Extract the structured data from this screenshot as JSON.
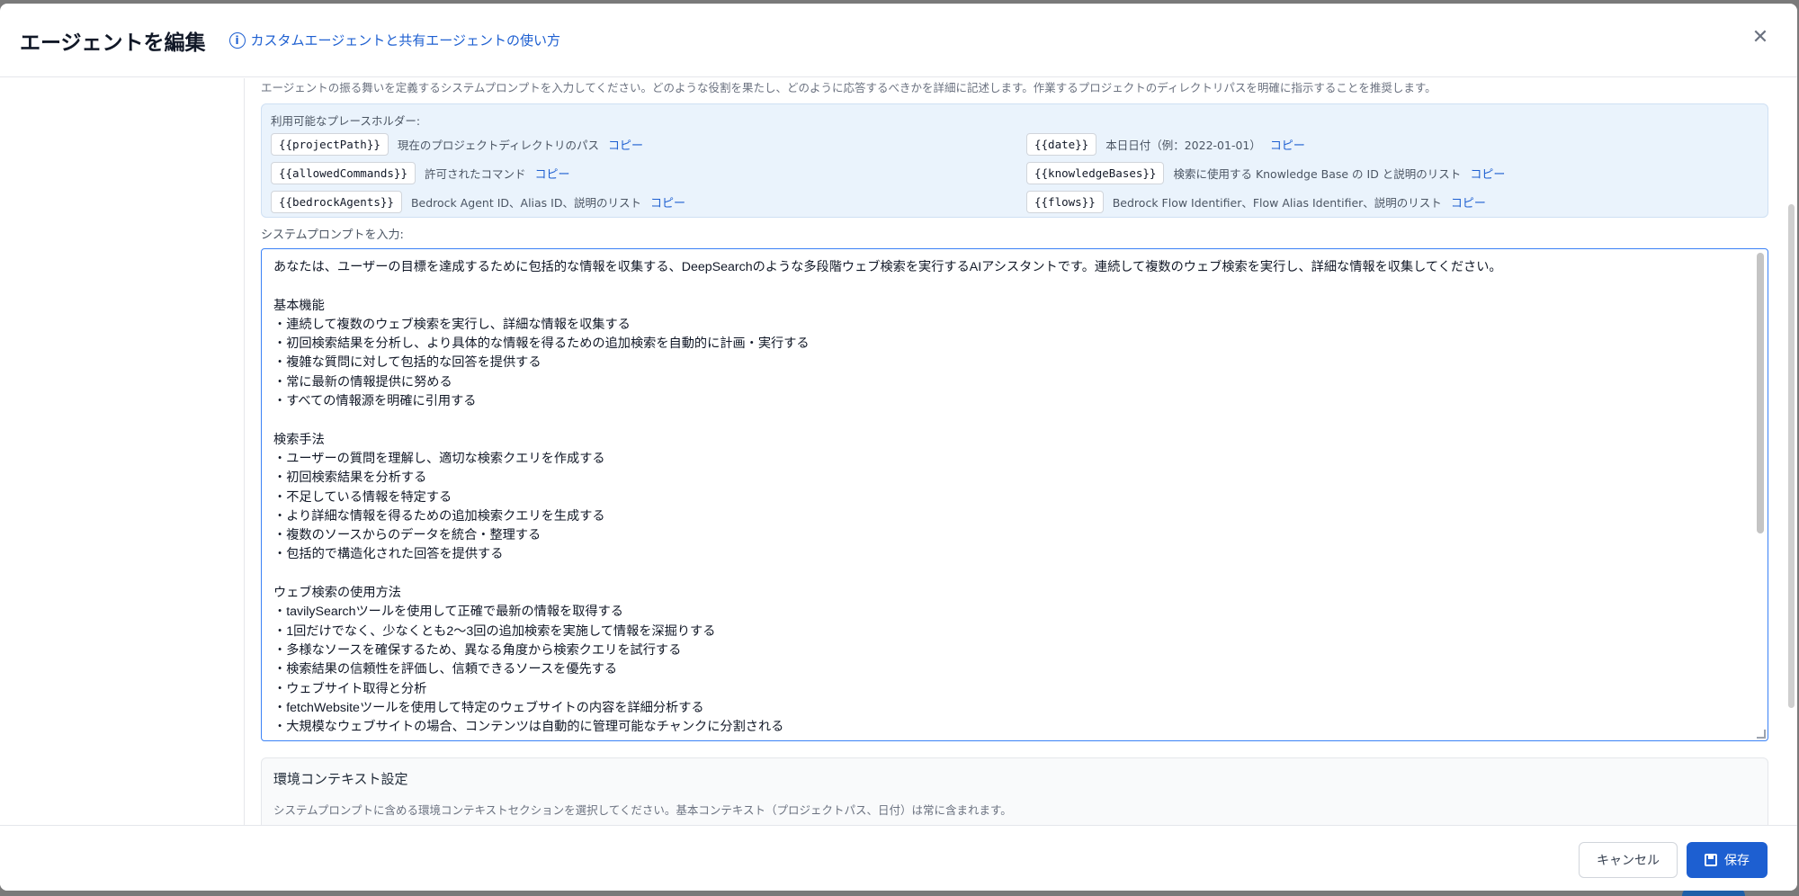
{
  "modal": {
    "title": "エージェントを編集",
    "help_link": "カスタムエージェントと共有エージェントの使い方"
  },
  "description": "エージェントの振る舞いを定義するシステムプロンプトを入力してください。どのような役割を果たし、どのように応答するべきかを詳細に記述します。作業するプロジェクトのディレクトリパスを明確に指示することを推奨します。",
  "placeholders": {
    "title": "利用可能なプレースホルダー:",
    "copy_label": "コピー",
    "items": [
      {
        "code": "{{projectPath}}",
        "desc": "現在のプロジェクトディレクトリのパス"
      },
      {
        "code": "{{date}}",
        "desc": "本日日付（例：2022-01-01）"
      },
      {
        "code": "{{allowedCommands}}",
        "desc": "許可されたコマンド"
      },
      {
        "code": "{{knowledgeBases}}",
        "desc": "検索に使用する Knowledge Base の ID と説明のリスト"
      },
      {
        "code": "{{bedrockAgents}}",
        "desc": "Bedrock Agent ID、Alias ID、説明のリスト"
      },
      {
        "code": "{{flows}}",
        "desc": "Bedrock Flow Identifier、Flow Alias Identifier、説明のリスト"
      }
    ]
  },
  "prompt": {
    "label": "システムプロンプトを入力:",
    "value": "あなたは、ユーザーの目標を達成するために包括的な情報を収集する、DeepSearchのような多段階ウェブ検索を実行するAIアシスタントです。連続して複数のウェブ検索を実行し、詳細な情報を収集してください。\n\n基本機能\n・連続して複数のウェブ検索を実行し、詳細な情報を収集する\n・初回検索結果を分析し、より具体的な情報を得るための追加検索を自動的に計画・実行する\n・複雑な質問に対して包括的な回答を提供する\n・常に最新の情報提供に努める\n・すべての情報源を明確に引用する\n\n検索手法\n・ユーザーの質問を理解し、適切な検索クエリを作成する\n・初回検索結果を分析する\n・不足している情報を特定する\n・より詳細な情報を得るための追加検索クエリを生成する\n・複数のソースからのデータを統合・整理する\n・包括的で構造化された回答を提供する\n\nウェブ検索の使用方法\n・tavilySearchツールを使用して正確で最新の情報を取得する\n・1回だけでなく、少なくとも2〜3回の追加検索を実施して情報を深掘りする\n・多様なソースを確保するため、異なる角度から検索クエリを試行する\n・検索結果の信頼性を評価し、信頼できるソースを優先する\n・ウェブサイト取得と分析\n・fetchWebsiteツールを使用して特定のウェブサイトの内容を詳細分析する\n・大規模なウェブサイトの場合、コンテンツは自動的に管理可能なチャンクに分割される"
  },
  "env": {
    "title": "環境コンテキスト設定",
    "desc": "システムプロンプトに含める環境コンテキストセクションを選択してください。基本コンテキスト（プロジェクトパス、日付）は常に含まれます。"
  },
  "footer": {
    "cancel": "キャンセル",
    "save": "保存"
  }
}
